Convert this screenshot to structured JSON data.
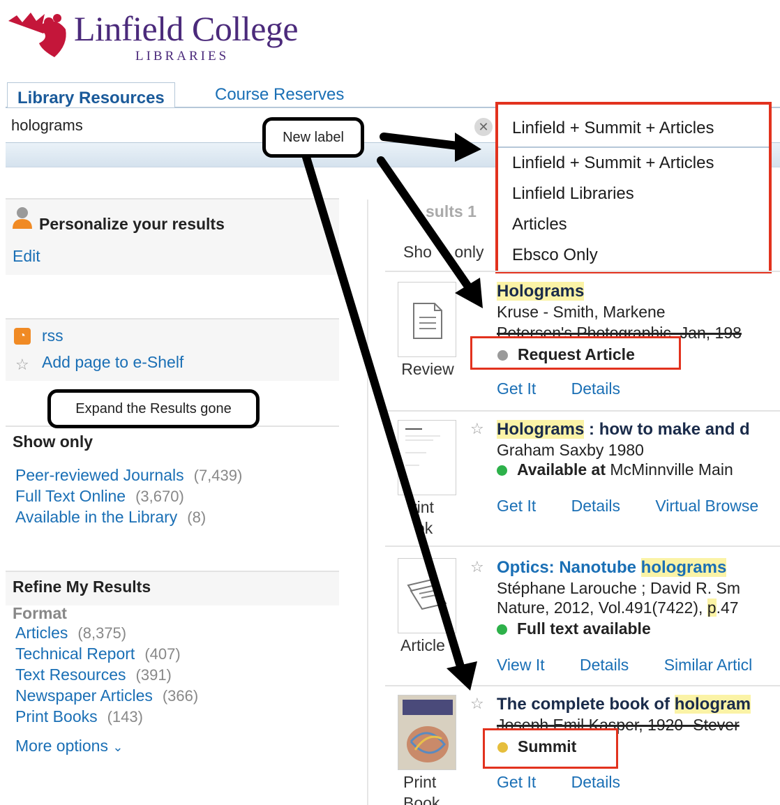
{
  "header": {
    "logo_title": "Linfield College",
    "logo_subtitle": "LIBRARIES"
  },
  "tabs": [
    {
      "label": "Library Resources",
      "active": true
    },
    {
      "label": "Course Reserves",
      "active": false
    }
  ],
  "search": {
    "query": "holograms",
    "scope_selected": "Linfield + Summit + Articles",
    "scope_options": [
      "Linfield + Summit + Articles",
      "Linfield Libraries",
      "Articles",
      "Ebsco Only"
    ]
  },
  "callouts": {
    "new_label": "New label",
    "expand_gone": "Expand the Results gone"
  },
  "sidebar": {
    "personalize_title": "Personalize your results",
    "edit_label": "Edit",
    "rss_label": "rss",
    "eshelf_label": "Add page to e-Shelf",
    "show_only_title": "Show only",
    "show_only": [
      {
        "label": "Peer-reviewed Journals",
        "count": "(7,439)"
      },
      {
        "label": "Full Text Online",
        "count": "(3,670)"
      },
      {
        "label": "Available in the Library",
        "count": "(8)"
      }
    ],
    "refine_title": "Refine My Results",
    "format_title": "Format",
    "formats": [
      {
        "label": "Articles",
        "count": "(8,375)"
      },
      {
        "label": "Technical Report",
        "count": "(407)"
      },
      {
        "label": "Text Resources",
        "count": "(391)"
      },
      {
        "label": "Newspaper Articles",
        "count": "(366)"
      },
      {
        "label": "Print Books",
        "count": "(143)"
      }
    ],
    "more_options": "More options"
  },
  "results_header": {
    "results_text": "sults 1",
    "show_only_text": "Sho",
    "show_only_text2": "only"
  },
  "results": [
    {
      "title_hl": "Holograms",
      "title_rest": "",
      "line1": "Kruse - Smith, Markene",
      "line2": "Petersen's Photographic, Jan, 198",
      "status": "Request Article",
      "status_color": "#9a9a9a",
      "type": "Review",
      "links": [
        "Get It",
        "Details"
      ]
    },
    {
      "title_hl": "Holograms",
      "title_rest": " : how to make and d",
      "line1": "Graham Saxby 1980",
      "status": "Available at",
      "status_rest": " McMinnville Main ",
      "status_color": "#2db14a",
      "type_a": "rint",
      "type_b": "ok",
      "links": [
        "Get It",
        "Details",
        "Virtual Browse"
      ]
    },
    {
      "title_pre": "Optics: Nanotube ",
      "title_hl": "holograms",
      "line1": "Stéphane Larouche ; David R. Sm",
      "line2_pre": "Nature, 2012, Vol.491(7422), ",
      "line2_hl": "p",
      "line2_rest": ".47",
      "status": "Full text available",
      "status_color": "#2db14a",
      "type": "Article",
      "links": [
        "View It",
        "Details",
        "Similar Articl"
      ]
    },
    {
      "title_pre": "The complete book of ",
      "title_hl": "hologram",
      "line1": "Joseph Emil Kasper, 1920- Stever",
      "status": "Summit",
      "status_color": "#e6be3c",
      "type_a": "Print",
      "type_b": "Book",
      "links": [
        "Get It",
        "Details"
      ]
    }
  ],
  "colors": {
    "brand_purple": "#4b2a7b",
    "link_blue": "#1a6fb5",
    "highlight_red": "#e2321e",
    "available_green": "#2db14a"
  }
}
